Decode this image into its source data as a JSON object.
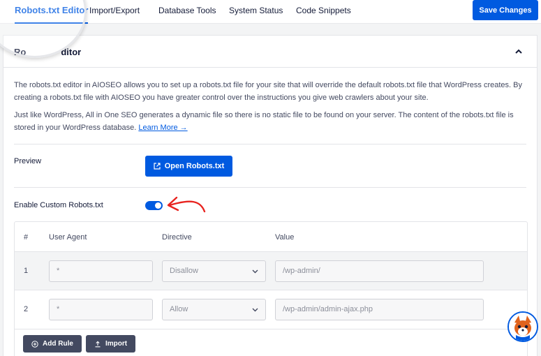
{
  "tabs": [
    {
      "label": "Robots.txt Editor",
      "active": true
    },
    {
      "label": "Import/Export"
    },
    {
      "label": "Database Tools"
    },
    {
      "label": "System Status"
    },
    {
      "label": "Code Snippets"
    }
  ],
  "save_label": "Save Changes",
  "card": {
    "title": "Robots.txt Editor",
    "visible_title": "Ro         ditor"
  },
  "description": {
    "p1": "The robots.txt editor in AIOSEO allows you to set up a robots.txt file for your site that will override the default robots.txt file that WordPress creates. By creating a robots.txt file with AIOSEO you have greater control over the instructions you give web crawlers about your site.",
    "p2": "Just like WordPress, All in One SEO generates a dynamic file so there is no static file to be found on your server. The content of the robots.txt file is stored in your WordPress database.",
    "learn_more": "Learn More →"
  },
  "preview": {
    "label": "Preview",
    "button_label": "Open Robots.txt"
  },
  "custom": {
    "label": "Enable Custom Robots.txt",
    "enabled": true
  },
  "table": {
    "headers": [
      "#",
      "User Agent",
      "Directive",
      "Value"
    ],
    "rows": [
      {
        "num": "1",
        "user_agent": "*",
        "directive": "Disallow",
        "value": "/wp-admin/"
      },
      {
        "num": "2",
        "user_agent": "*",
        "directive": "Allow",
        "value": "/wp-admin/admin-ajax.php"
      }
    ]
  },
  "buttons": {
    "add_rule": "Add Rule",
    "import": "Import"
  },
  "colors": {
    "primary": "#005ae0",
    "dark_button": "#434960",
    "annotation_arrow": "#e8231f"
  },
  "icons": {
    "external_link": "external-link-icon",
    "add_rule": "plus-circle-icon",
    "import": "upload-icon",
    "collapse": "chevron-up-icon"
  }
}
